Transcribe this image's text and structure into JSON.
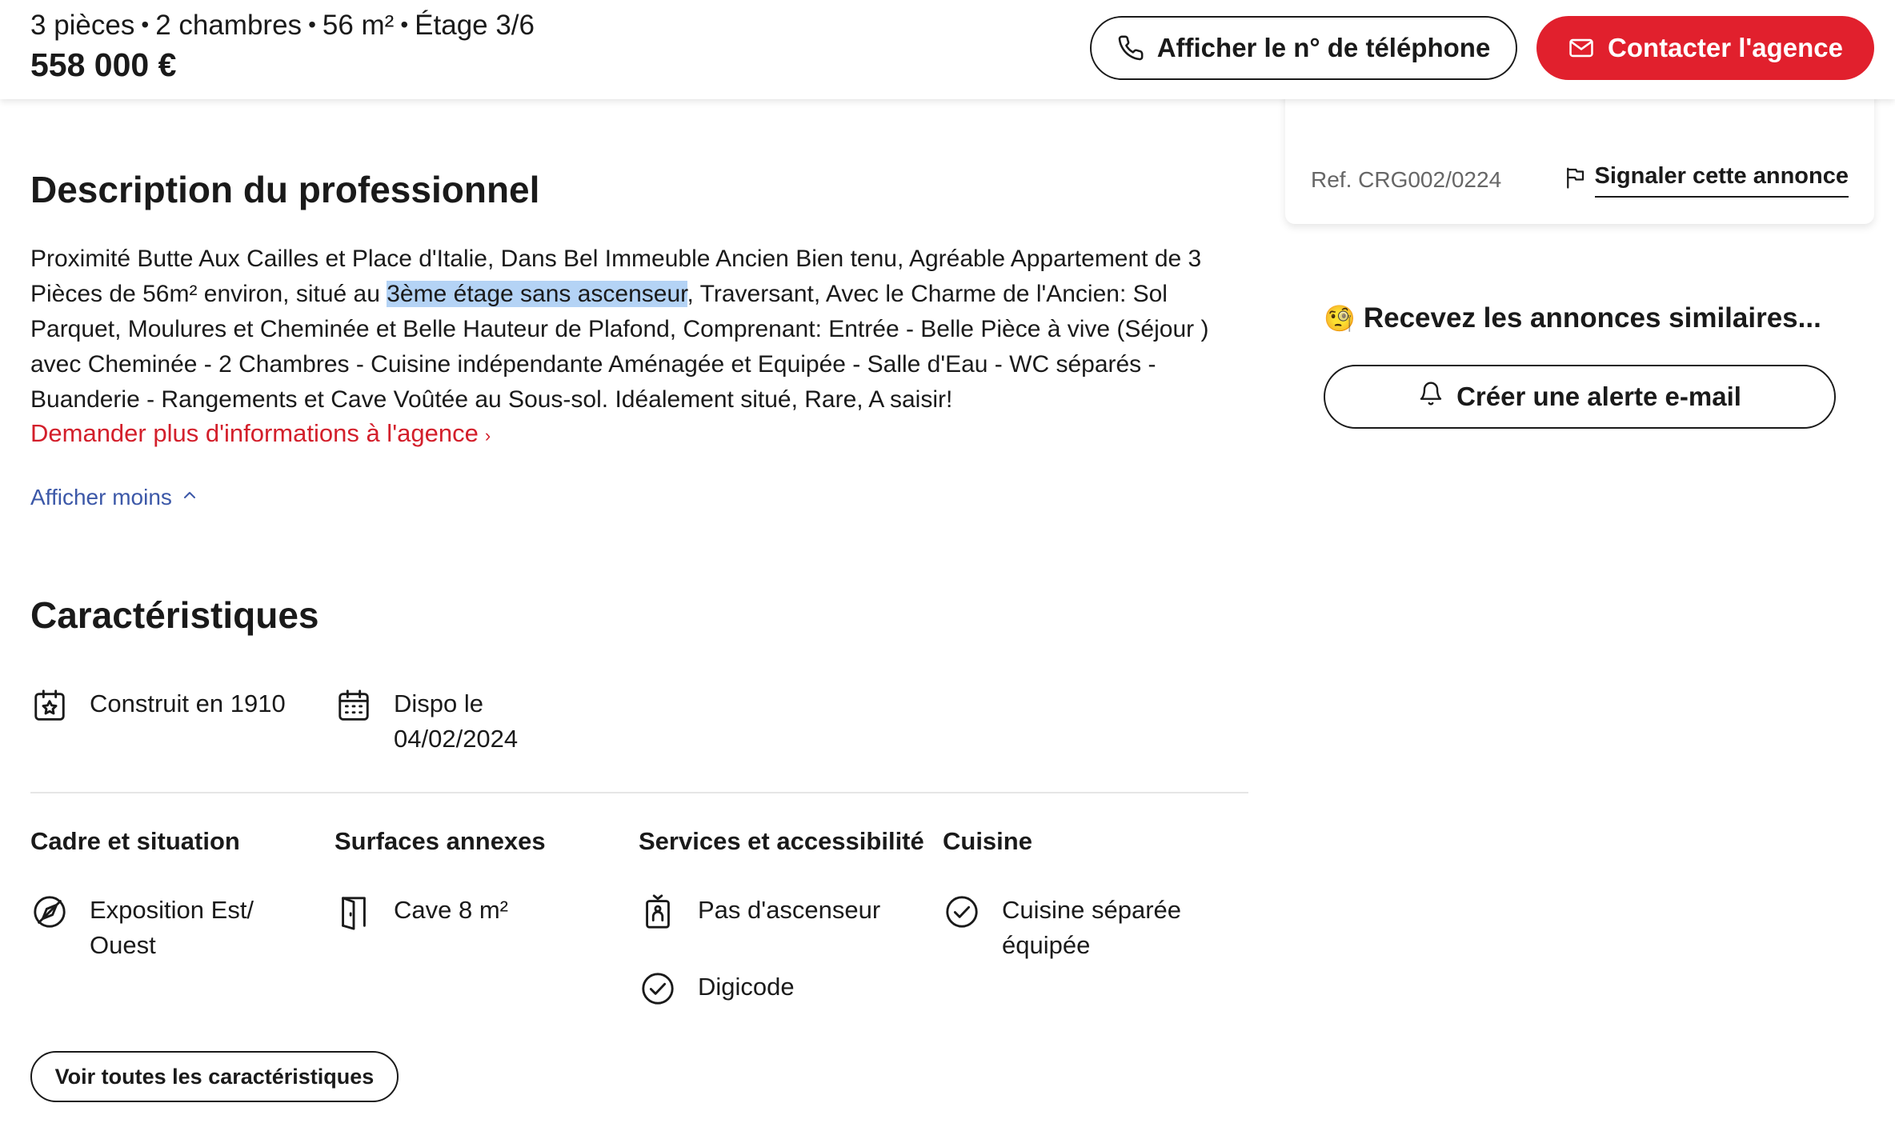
{
  "header": {
    "summary": [
      "3 pièces",
      "2 chambres",
      "56 m²",
      "Étage 3/6"
    ],
    "summary_separator": "•",
    "price": "558 000 €",
    "phone_button_label": "Afficher le n° de téléphone",
    "contact_button_label": "Contacter l'agence"
  },
  "side": {
    "ref": "Ref. CRG002/0224",
    "report_label": "Signaler cette annonce",
    "alert_emoji": "🧐",
    "alert_title": "Recevez les annonces similaires...",
    "alert_button_label": "Créer une alerte e-mail"
  },
  "description": {
    "title": "Description du professionnel",
    "text_before": "Proximité Butte Aux Cailles et Place d'Italie, Dans Bel Immeuble Ancien Bien tenu, Agréable Appartement de 3 Pièces de 56m² environ, situé au ",
    "text_highlight": "3ème étage sans ascenseur",
    "text_after": ", Traversant, Avec le Charme de l'Ancien: Sol Parquet, Moulures et Cheminée et Belle Hauteur de Plafond, Comprenant: Entrée - Belle Pièce à vive (Séjour ) avec Cheminée - 2 Chambres - Cuisine indépendante Aménagée et Equipée - Salle d'Eau - WC séparés - Buanderie - Rangements et Cave Voûtée au Sous-sol. Idéalement situé, Rare, A saisir!",
    "more_info_link": "Demander plus d'informations à l'agence",
    "more_info_chevron": "›",
    "show_less": "Afficher moins"
  },
  "characteristics": {
    "title": "Caractéristiques",
    "built": "Construit en 1910",
    "available_line1": "Dispo le",
    "available_line2": "04/02/2024",
    "columns": [
      {
        "title": "Cadre et situation",
        "items": [
          [
            "Exposition Est/",
            "Ouest"
          ]
        ]
      },
      {
        "title": "Surfaces annexes",
        "items": [
          [
            "Cave 8 m²"
          ]
        ]
      },
      {
        "title": "Services et accessibilité",
        "items": [
          [
            "Pas d'ascenseur"
          ],
          [
            "Digicode"
          ]
        ]
      },
      {
        "title": "Cuisine",
        "items": [
          [
            "Cuisine séparée",
            "équipée"
          ]
        ]
      }
    ],
    "all_button_label": "Voir toutes les caractéristiques"
  },
  "icons": [
    "phone-icon",
    "mail-icon",
    "flag-icon",
    "bell-icon",
    "calendar-star-icon",
    "calendar-icon",
    "compass-icon",
    "door-icon",
    "elevator-icon",
    "check-circle-icon",
    "chevron-up-icon"
  ],
  "colors": {
    "accent_red": "#e1202d",
    "link_red": "#d31f2b",
    "link_blue": "#3c58a8",
    "highlight": "#b4d3f5"
  }
}
